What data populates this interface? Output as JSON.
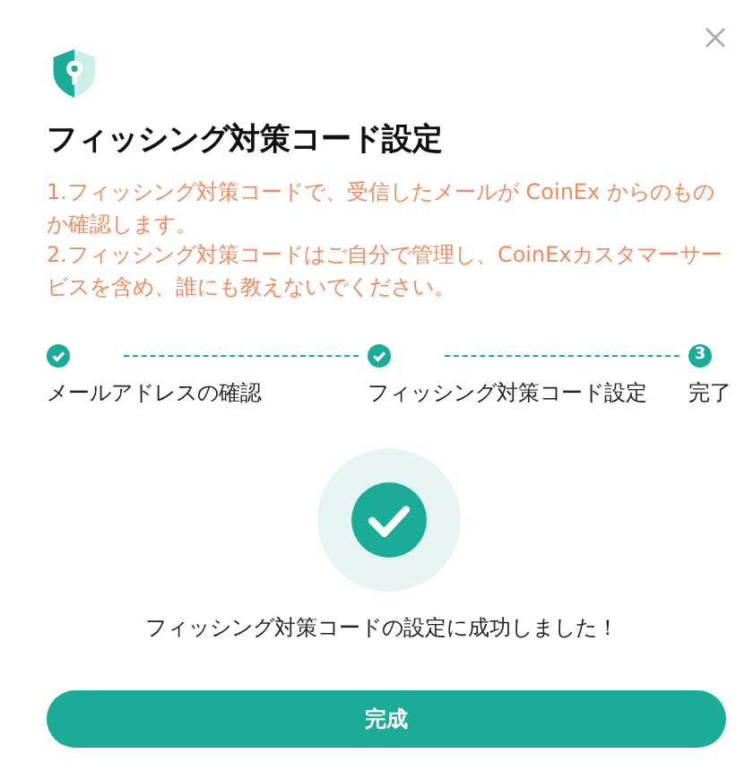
{
  "dialog": {
    "title": "フィッシング対策コード設定",
    "notes": [
      "1.フィッシング対策コードで、受信したメールが CoinEx からのものか確認します。",
      "2.フィッシング対策コードはご自分で管理し、CoinExカスタマーサービスを含め、誰にも教えないでください。"
    ],
    "steps": [
      {
        "label": "メールアドレスの確認",
        "done": true
      },
      {
        "label": "フィッシング対策コード設定",
        "done": true
      },
      {
        "label": "完了",
        "done": false,
        "number": "3"
      }
    ],
    "message": "フィッシング対策コードの設定に成功しました！",
    "button": "完成"
  }
}
